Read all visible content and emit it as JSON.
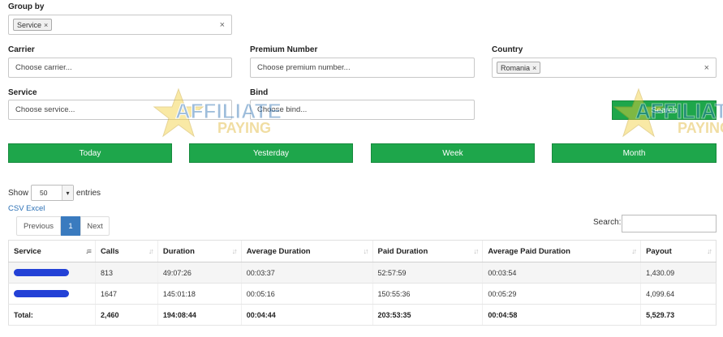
{
  "group_by": {
    "label": "Group by",
    "tags": [
      "Service"
    ]
  },
  "filters": {
    "carrier": {
      "label": "Carrier",
      "placeholder": "Choose carrier..."
    },
    "premium_number": {
      "label": "Premium Number",
      "placeholder": "Choose premium number..."
    },
    "country": {
      "label": "Country",
      "tags": [
        "Romania"
      ]
    },
    "service": {
      "label": "Service",
      "placeholder": "Choose service..."
    },
    "bind": {
      "label": "Bind",
      "placeholder": "Choose bind..."
    },
    "search_label": "Search"
  },
  "period_buttons": [
    "Today",
    "Yesterday",
    "Week",
    "Month"
  ],
  "length": {
    "show": "Show",
    "value": "50",
    "entries": "entries"
  },
  "export": "CSV Excel",
  "pagination": {
    "previous": "Previous",
    "current": "1",
    "next": "Next"
  },
  "table_search_label": "Search:",
  "watermark": {
    "line1": "AFFILIATE",
    "line2": "PAYING"
  },
  "colors": {
    "accent_green": "#1ea64b",
    "pager_blue": "#3a7bbf",
    "redaction_blue": "#2341d6"
  },
  "table": {
    "columns": [
      "Service",
      "Calls",
      "Duration",
      "Average Duration",
      "Paid Duration",
      "Average Paid Duration",
      "Payout"
    ],
    "rows": [
      [
        "",
        "813",
        "49:07:26",
        "00:03:37",
        "52:57:59",
        "00:03:54",
        "1,430.09"
      ],
      [
        "",
        "1647",
        "145:01:18",
        "00:05:16",
        "150:55:36",
        "00:05:29",
        "4,099.64"
      ]
    ],
    "total": [
      "Total:",
      "2,460",
      "194:08:44",
      "00:04:44",
      "203:53:35",
      "00:04:58",
      "5,529.73"
    ]
  }
}
